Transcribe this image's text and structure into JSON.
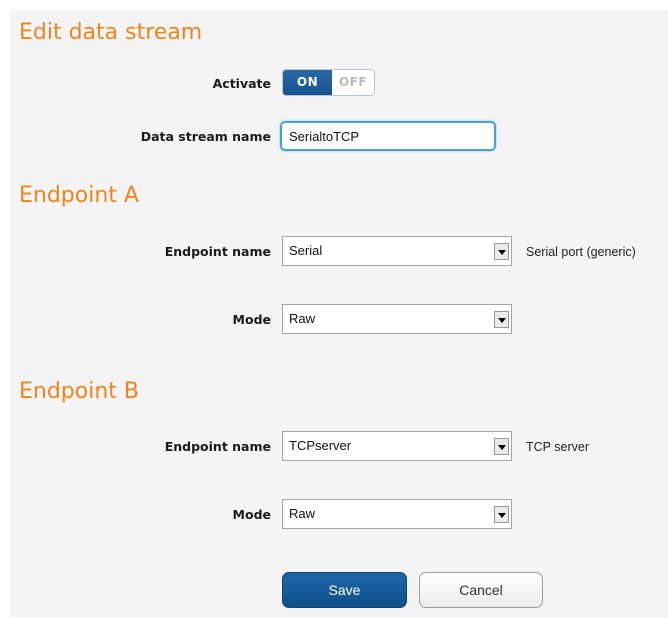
{
  "page": {
    "title": "Edit data stream",
    "activate": {
      "label": "Activate",
      "on_label": "ON",
      "off_label": "OFF",
      "state": "on"
    },
    "stream_name": {
      "label": "Data stream name",
      "value": "SerialtoTCP"
    }
  },
  "endpoint_a": {
    "title": "Endpoint A",
    "name": {
      "label": "Endpoint name",
      "value": "Serial",
      "hint": "Serial port (generic)"
    },
    "mode": {
      "label": "Mode",
      "value": "Raw"
    }
  },
  "endpoint_b": {
    "title": "Endpoint B",
    "name": {
      "label": "Endpoint name",
      "value": "TCPserver",
      "hint": "TCP server"
    },
    "mode": {
      "label": "Mode",
      "value": "Raw"
    }
  },
  "actions": {
    "save_label": "Save",
    "cancel_label": "Cancel"
  },
  "colors": {
    "heading": "#f0831e",
    "primary": "#15528e",
    "focus": "#4aa0d6",
    "panel_bg": "#f4f4f4"
  },
  "icons": {
    "select_arrow": "chevron-down-icon"
  }
}
